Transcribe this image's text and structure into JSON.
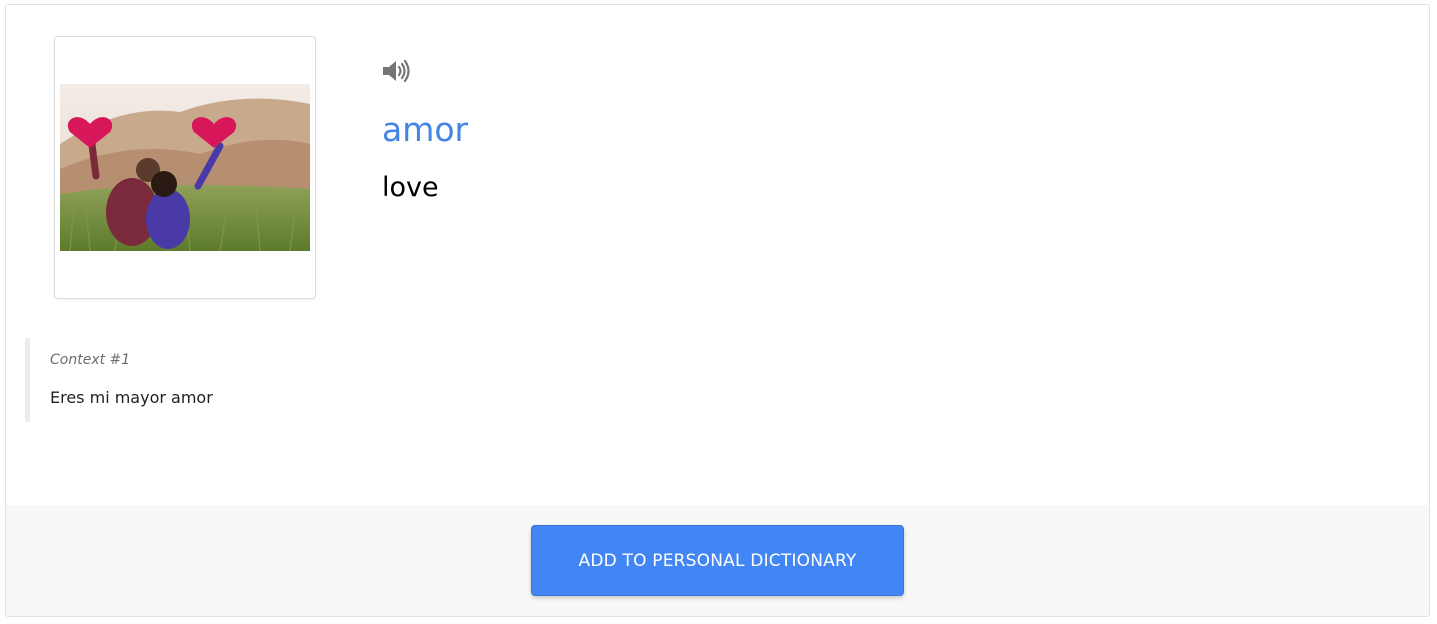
{
  "word": {
    "term": "amor",
    "translation": "love",
    "audio_icon": "speaker-volume-icon",
    "image_alt": "couple holding red hearts in a field"
  },
  "context": {
    "label": "Context #1",
    "sentence": "Eres mi mayor amor"
  },
  "actions": {
    "add_label": "ADD TO PERSONAL DICTIONARY"
  },
  "colors": {
    "term": "#4285e6",
    "button": "#4285f4",
    "footer_bg": "#f8f8f8",
    "heart": "#d8175a"
  }
}
